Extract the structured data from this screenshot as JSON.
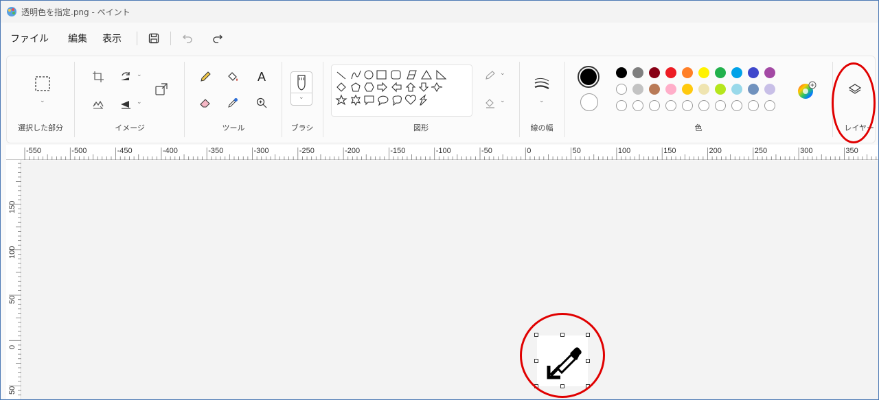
{
  "window": {
    "title": "透明色を指定.png - ペイント"
  },
  "menu": {
    "file": "ファイル",
    "edit": "編集",
    "view": "表示"
  },
  "ribbon": {
    "selection": {
      "label": "選択した部分"
    },
    "image": {
      "label": "イメージ"
    },
    "tools": {
      "label": "ツール",
      "text_tool": "A"
    },
    "brush": {
      "label": "ブラシ"
    },
    "shapes": {
      "label": "図形"
    },
    "line_width": {
      "label": "線の幅"
    },
    "colors": {
      "label": "色",
      "primary": "#000000",
      "secondary": "#ffffff",
      "palette_row1": [
        "#000000",
        "#7f7f7f",
        "#880015",
        "#ed1c24",
        "#ff7f27",
        "#fff200",
        "#22b14c",
        "#00a2e8",
        "#3f48cc",
        "#a349a4"
      ],
      "palette_row2": [
        "#ffffff",
        "#c3c3c3",
        "#b97a57",
        "#ffaec9",
        "#ffc90e",
        "#efe4b0",
        "#b5e61d",
        "#99d9ea",
        "#7092be",
        "#c8bfe7"
      ]
    },
    "layers": {
      "label": "レイヤー"
    }
  },
  "rulers": {
    "top_ticks": [
      "-550",
      "-500",
      "-450",
      "-400",
      "-350",
      "-300",
      "-250",
      "-200",
      "-150",
      "-100",
      "-50",
      "0",
      "50",
      "100",
      "150",
      "200",
      "250",
      "300",
      "350"
    ],
    "left_ticks": [
      "150",
      "100",
      "50",
      "0",
      "50"
    ]
  },
  "highlight_color": "#e00000"
}
